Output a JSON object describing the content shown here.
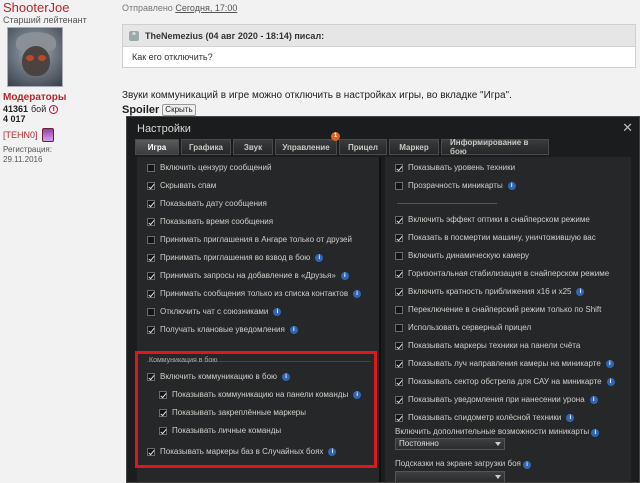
{
  "forum": {
    "username": "ShooterJoe",
    "rank": "Старший лейтенант",
    "role": "Модераторы",
    "battles_count": "41361",
    "battles_label": "бой",
    "rating": "4 017",
    "clan_tag": "[TEHN0]",
    "reg_label": "Регистрация:",
    "reg_date": "29.11.2016",
    "sent_prefix": "Отправлено",
    "sent_day": "Сегодня, 17:00",
    "quote_header": "TheNemezius (04 авг 2020 - 18:14) писал:",
    "quote_text": "Как его отключить?",
    "post_text": "Звуки коммуникаций в игре можно отключить в настройках игры, во вкладке \"Игра\".",
    "spoiler_label": "Spoiler",
    "spoiler_button": "Скрыть"
  },
  "game": {
    "title": "Настройки",
    "close": "✕",
    "tabs": [
      {
        "label": "Игра",
        "active": true
      },
      {
        "label": "Графика"
      },
      {
        "label": "Звук"
      },
      {
        "label": "Управление",
        "badge": "1"
      },
      {
        "label": "Прицел"
      },
      {
        "label": "Маркер"
      },
      {
        "label": "Информирование в бою"
      }
    ],
    "left_options": [
      {
        "label": "Включить цензуру сообщений",
        "checked": false
      },
      {
        "label": "Скрывать спам",
        "checked": true
      },
      {
        "label": "Показывать дату сообщения",
        "checked": true
      },
      {
        "label": "Показывать время сообщения",
        "checked": true
      },
      {
        "label": "Принимать приглашения в Ангаре только от друзей",
        "checked": false
      },
      {
        "label": "Принимать приглашения во взвод в бою",
        "checked": true,
        "info": true
      },
      {
        "label": "Принимать запросы на добавление в «Друзья»",
        "checked": true,
        "info": true
      },
      {
        "label": "Принимать сообщения только из списка контактов",
        "checked": true,
        "info": true
      },
      {
        "label": "Отключить чат с союзниками",
        "checked": false,
        "info": true
      },
      {
        "label": "Получать клановые уведомления",
        "checked": true,
        "info": true
      }
    ],
    "comm_group_title": "Коммуникация в бою",
    "comm_options": [
      {
        "label": "Включить коммуникацию в бою",
        "checked": true,
        "info": true
      },
      {
        "label": "Показывать коммуникацию на панели команды",
        "checked": true,
        "info": true
      },
      {
        "label": "Показывать закреплённые маркеры",
        "checked": true
      },
      {
        "label": "Показывать личные команды",
        "checked": true
      },
      {
        "label": "Показывать маркеры баз в Случайных боях",
        "checked": true,
        "info": true
      }
    ],
    "right_options_top": [
      {
        "label": "Показывать уровень техники",
        "checked": true
      },
      {
        "label": "Прозрачность миникарты",
        "checked": false,
        "info": true
      }
    ],
    "right_options": [
      {
        "label": "Включить эффект оптики в снайперском режиме",
        "checked": true
      },
      {
        "label": "Показать в посмертии машину, уничтожившую вас",
        "checked": true
      },
      {
        "label": "Включить динамическую камеру",
        "checked": false
      },
      {
        "label": "Горизонтальная стабилизация в снайперском режиме",
        "checked": true
      },
      {
        "label": "Включить кратность приближения x16 и x25",
        "checked": true,
        "info": true
      },
      {
        "label": "Переключение в снайперский режим только по Shift",
        "checked": false
      },
      {
        "label": "Использовать серверный прицел",
        "checked": false
      },
      {
        "label": "Показывать маркеры техники на панели счёта",
        "checked": true
      },
      {
        "label": "Показывать луч направления камеры на миникарте",
        "checked": true,
        "info": true
      },
      {
        "label": "Показывать сектор обстрела для САУ на миникарте",
        "checked": true,
        "info": true
      },
      {
        "label": "Показывать уведомления при нанесении урона",
        "checked": true,
        "info": true
      },
      {
        "label": "Показывать спидометр колёсной техники",
        "checked": true,
        "info": true
      }
    ],
    "minimap_label": "Включить дополнительные возможности миникарты",
    "minimap_value": "Постоянно",
    "loading_label": "Подсказки на экране загрузки боя",
    "colors": {
      "highlight": "#e0161c",
      "info": "#2f66b5",
      "badge": "#e2611a"
    }
  }
}
